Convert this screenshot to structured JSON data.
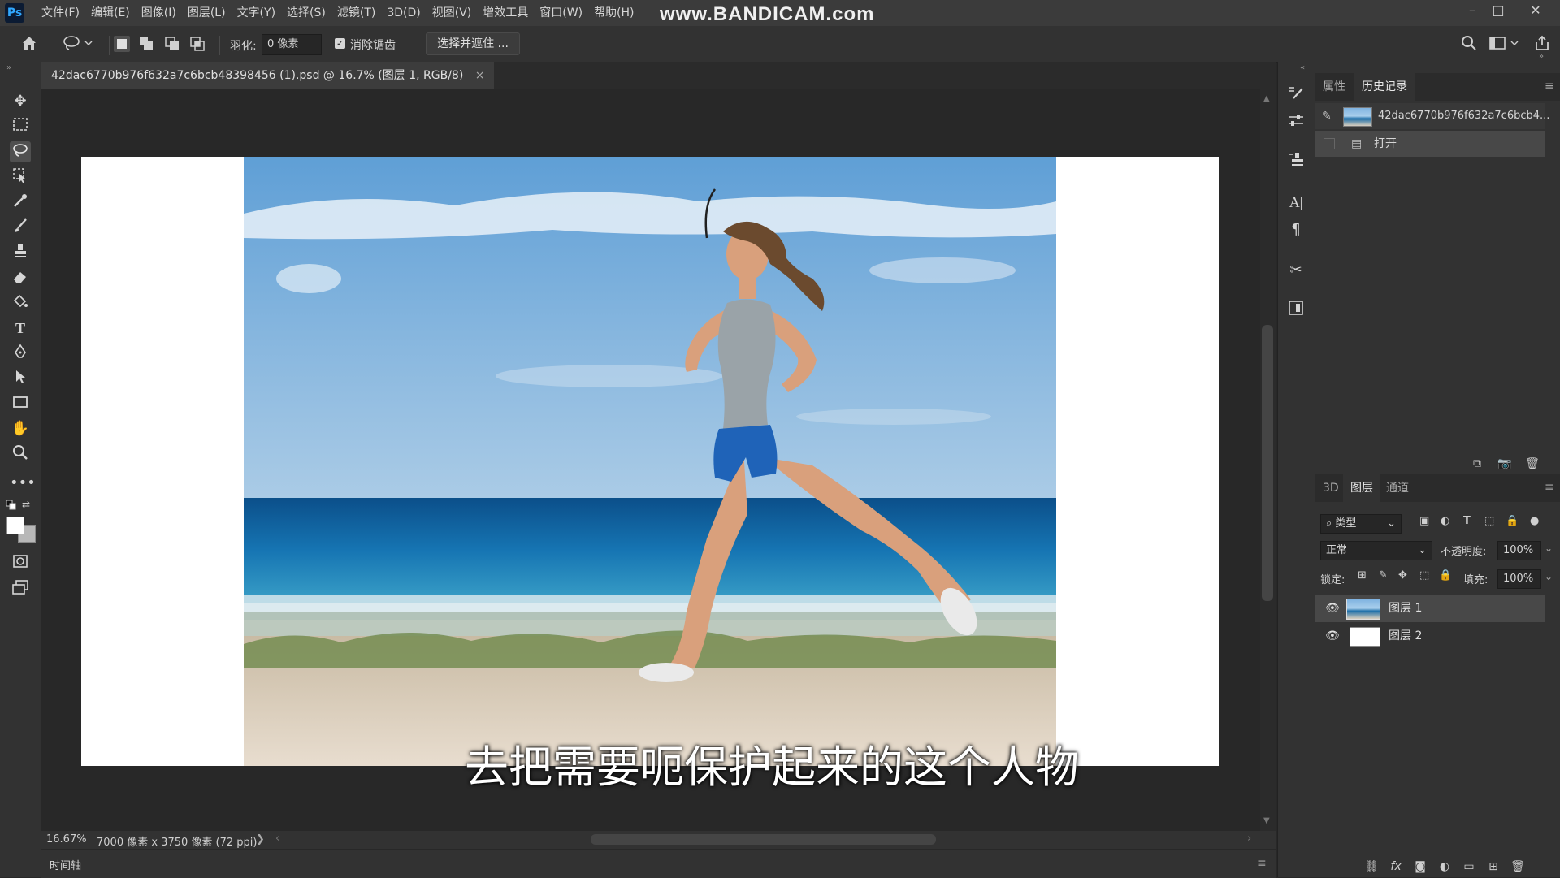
{
  "app": {
    "logo": "Ps",
    "menu": [
      "文件(F)",
      "编辑(E)",
      "图像(I)",
      "图层(L)",
      "文字(Y)",
      "选择(S)",
      "滤镜(T)",
      "3D(D)",
      "视图(V)",
      "增效工具",
      "窗口(W)",
      "帮助(H)"
    ],
    "watermark": "www.BANDICAM.com",
    "window_controls": [
      "–",
      "□",
      "✕"
    ]
  },
  "options_bar": {
    "feather_label": "羽化:",
    "feather_value": "0 像素",
    "antialias_label": "消除锯齿",
    "antialias_checked": true,
    "select_mask_button": "选择并遮住 ..."
  },
  "document": {
    "tab_title": "42dac6770b976f632a7c6bcb48398456 (1).psd @ 16.7% (图层 1, RGB/8)",
    "close": "×",
    "subtitle": "去把需要呃保护起来的这个人物"
  },
  "status": {
    "zoom": "16.67%",
    "doc_info": "7000 像素 x 3750 像素 (72 ppi)",
    "arrow": "❯"
  },
  "timeline": {
    "label": "时间轴"
  },
  "panel_top": {
    "tabs": [
      "属性",
      "历史记录"
    ],
    "active_tab": "历史记录",
    "snapshot_name": "42dac6770b976f632a7c6bcb4...",
    "history_items": [
      "打开"
    ]
  },
  "panel_layers": {
    "tabs": [
      "3D",
      "图层",
      "通道"
    ],
    "active_tab": "图层",
    "filter_kind": "类型",
    "blend_mode": "正常",
    "opacity_label": "不透明度:",
    "opacity_value": "100%",
    "lock_label": "锁定:",
    "fill_label": "填充:",
    "fill_value": "100%",
    "layers": [
      {
        "name": "图层 1",
        "selected": true,
        "visible": true
      },
      {
        "name": "图层 2",
        "selected": false,
        "visible": true
      }
    ]
  },
  "colors": {
    "accent": "#31a8ff",
    "panel_bg": "#323232",
    "canvas_bg": "#282828",
    "selected_row": "#484848"
  }
}
